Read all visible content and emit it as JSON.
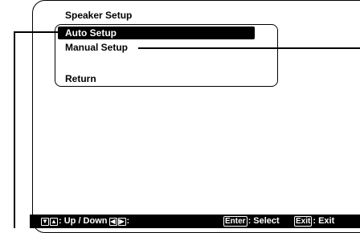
{
  "menu": {
    "title": "Speaker Setup",
    "items": [
      {
        "label": "Auto Setup",
        "selected": true
      },
      {
        "label": "Manual Setup",
        "selected": false
      },
      {
        "label": "Return",
        "selected": false
      }
    ]
  },
  "statusbar": {
    "updown_label": ": Up / Down",
    "leftright_label": ":",
    "enter_key": "Enter",
    "enter_label": ": Select",
    "exit_key": "Exit",
    "exit_label": ": Exit"
  },
  "icons": [
    "down-arrow-key-icon",
    "up-arrow-key-icon",
    "left-arrow-key-icon",
    "right-arrow-key-icon"
  ]
}
